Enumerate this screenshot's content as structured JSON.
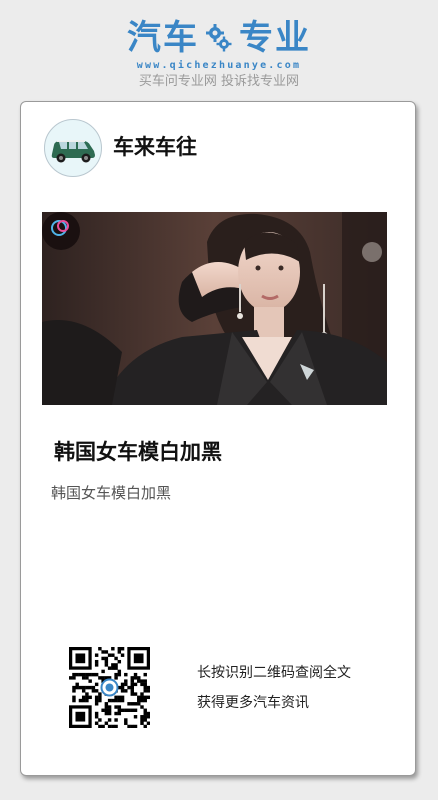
{
  "logo": {
    "word_left": "汽车",
    "word_right": "专业",
    "url": "www.qichezhuanye.com",
    "slogan": "买车问专业网 投诉找专业网",
    "gear_icon": "gear-icon"
  },
  "card": {
    "author": "车来车往",
    "avatar_icon": "car-icon",
    "photo": "woman-at-auto-show-photo",
    "article_title": "韩国女车模白加黑",
    "article_desc": "韩国女车模白加黑",
    "qr_icon": "qr-code-icon",
    "qr_caption_1": "长按识别二维码查阅全文",
    "qr_caption_2": "获得更多汽车资讯"
  },
  "colors": {
    "brand_blue": "#3a86c6",
    "background": "#ececec",
    "card": "#ffffff"
  }
}
